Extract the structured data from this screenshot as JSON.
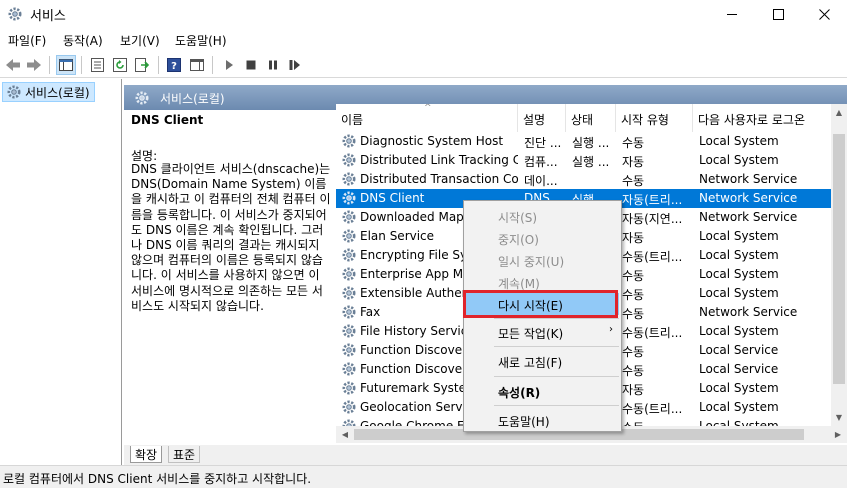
{
  "window": {
    "title": "서비스",
    "controls": {
      "minimize": "—",
      "maximize": "☐",
      "close": "✕"
    }
  },
  "menubar": [
    {
      "label": "파일(F)"
    },
    {
      "label": "동작(A)"
    },
    {
      "label": "보기(V)"
    },
    {
      "label": "도움말(H)"
    }
  ],
  "toolbar": {
    "icons": [
      "back-icon",
      "forward-icon",
      "console-tree-icon",
      "properties-list-icon",
      "refresh-icon",
      "export-icon",
      "help-icon",
      "show-hide-icon",
      "play-icon",
      "stop-icon",
      "pause-icon",
      "restart-icon"
    ]
  },
  "tree": {
    "item": "서비스(로컬)"
  },
  "pane": {
    "header": "서비스(로컬)",
    "selected_title": "DNS Client",
    "desc_label": "설명:",
    "desc_body": "DNS 클라이언트 서비스(dnscache)는 DNS(Domain Name System) 이름을 캐시하고 이 컴퓨터의 전체 컴퓨터 이름을 등록합니다. 이 서비스가 중지되어도 DNS 이름은 계속 확인됩니다. 그러나 DNS 이름 쿼리의 결과는 캐시되지 않으며 컴퓨터의 이름은 등록되지 않습니다. 이 서비스를 사용하지 않으면 이 서비스에 명시적으로 의존하는 모든 서비스도 시작되지 않습니다."
  },
  "list": {
    "columns": [
      "이름",
      "설명",
      "상태",
      "시작 유형",
      "다음 사용자로 로그온"
    ],
    "sort_indicator": "^",
    "rows": [
      {
        "name": "Diagnostic System Host",
        "desc": "진단 ...",
        "status": "실행 ...",
        "start": "수동",
        "logon": "Local System"
      },
      {
        "name": "Distributed Link Tracking C...",
        "desc": "컴퓨...",
        "status": "실행 ...",
        "start": "자동",
        "logon": "Local System"
      },
      {
        "name": "Distributed Transaction Co...",
        "desc": "데이...",
        "status": "",
        "start": "수동",
        "logon": "Network Service"
      },
      {
        "name": "DNS Client",
        "desc": "DNS ...",
        "status": "실행 ...",
        "start": "자동(트리...",
        "logon": "Network Service",
        "selected": true
      },
      {
        "name": "Downloaded Maps",
        "desc": "",
        "status": "",
        "start": "자동(지연...",
        "logon": "Network Service"
      },
      {
        "name": "Elan Service",
        "desc": "",
        "status": "",
        "start": "자동",
        "logon": "Local System"
      },
      {
        "name": "Encrypting File Syst",
        "desc": "",
        "status": "",
        "start": "수동(트리...",
        "logon": "Local System"
      },
      {
        "name": "Enterprise App Mar",
        "desc": "",
        "status": "",
        "start": "수동",
        "logon": "Local System"
      },
      {
        "name": "Extensible Authenti",
        "desc": "",
        "status": "",
        "start": "수동",
        "logon": "Local System"
      },
      {
        "name": "Fax",
        "desc": "",
        "status": "",
        "start": "수동",
        "logon": "Network Service"
      },
      {
        "name": "File History Service",
        "desc": "",
        "status": "",
        "start": "수동(트리...",
        "logon": "Local System"
      },
      {
        "name": "Function Discovery",
        "desc": "",
        "status": "",
        "start": "수동",
        "logon": "Local Service"
      },
      {
        "name": "Function Discovery",
        "desc": "",
        "status": "",
        "start": "수동",
        "logon": "Local Service"
      },
      {
        "name": "Futuremark System",
        "desc": "",
        "status": "",
        "start": "자동",
        "logon": "Local System"
      },
      {
        "name": "Geolocation Service",
        "desc": "",
        "status": "",
        "start": "수동(트리...",
        "logon": "Local System"
      },
      {
        "name": "Google Chrome Ele...",
        "desc": "",
        "status": "",
        "start": "수동",
        "logon": "Local System"
      }
    ]
  },
  "context_menu": {
    "items": [
      {
        "label": "시작(S)",
        "disabled": true
      },
      {
        "label": "중지(O)",
        "disabled": true
      },
      {
        "label": "일시 중지(U)",
        "disabled": true
      },
      {
        "label": "계속(M)",
        "disabled": true
      },
      {
        "label": "다시 시작(E)",
        "highlighted": true
      },
      {
        "label": "모든 작업(K)",
        "submenu": "›"
      },
      {
        "label": "새로 고침(F)"
      },
      {
        "label": "속성(R)",
        "bold": true
      },
      {
        "label": "도움말(H)"
      }
    ],
    "highlight_color": "#e0242b"
  },
  "tabs": [
    {
      "label": "확장"
    },
    {
      "label": "표준"
    }
  ],
  "statusbar": {
    "text": "로컬 컴퓨터에서 DNS Client 서비스를 중지하고 시작합니다."
  },
  "colors": {
    "selection": "#0078d7",
    "pane_header": "#7d99bd",
    "tree_selection": "#cde8ff",
    "menu_highlight": "#91c9f7"
  }
}
